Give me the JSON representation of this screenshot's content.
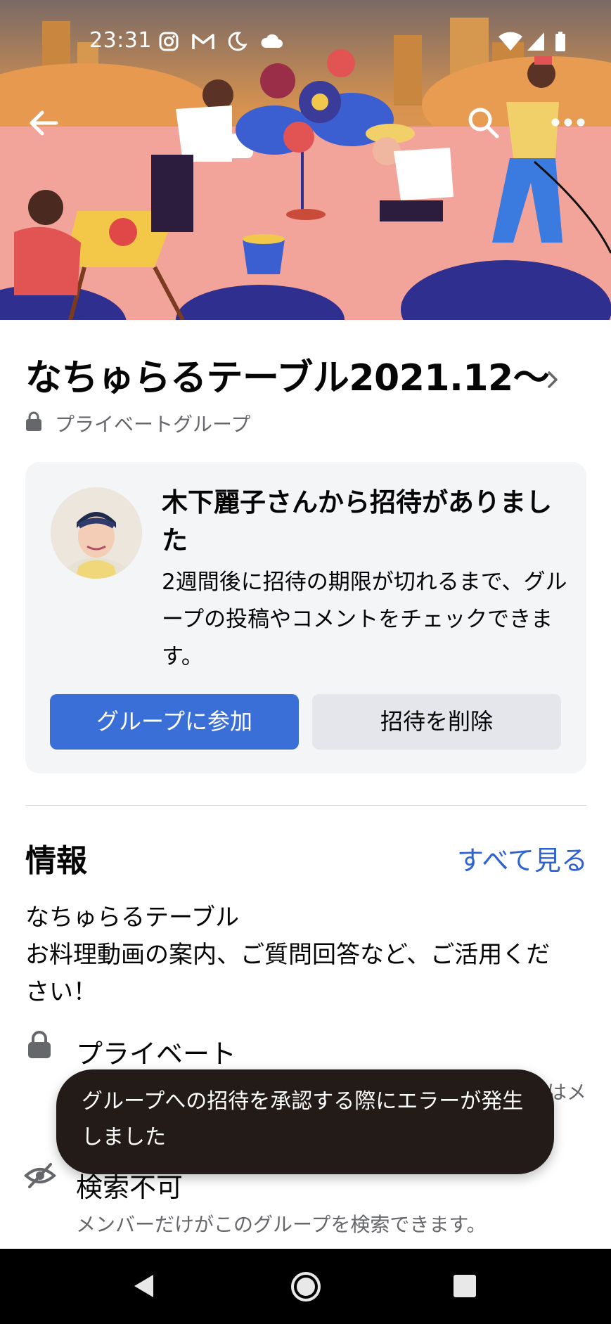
{
  "status_bar": {
    "time": "23:31",
    "icons": [
      "instagram-icon",
      "gmail-icon",
      "do-not-disturb-icon",
      "cloud-icon",
      "wifi-icon",
      "signal-icon",
      "battery-icon"
    ]
  },
  "cover_nav": {
    "back_icon": "back-arrow-icon",
    "search_icon": "search-icon",
    "more_icon": "more-icon"
  },
  "group": {
    "title": "なちゅらるテーブル2021.12〜",
    "privacy_label": "プライベートグループ"
  },
  "invite": {
    "title": "木下麗子さんから招待がありました",
    "description": "2週間後に招待の期限が切れるまで、グループの投稿やコメントをチェックできます。",
    "join_label": "グループに参加",
    "delete_label": "招待を削除"
  },
  "info": {
    "heading": "情報",
    "see_all": "すべて見る",
    "description_lines": [
      "なちゅらるテーブル",
      "お料理動画の案内、ご質問回答など、ご活用くだ",
      "さい！"
    ],
    "private_title": "プライベート",
    "private_clipped": "はメ",
    "hidden_title": "検索不可",
    "hidden_desc": "メンバーだけがこのグループを検索できます。"
  },
  "toast": {
    "message": "グループへの招待を承認する際にエラーが発生しました"
  },
  "nav_bar": {
    "back": "nav-back-icon",
    "home": "nav-home-icon",
    "recents": "nav-recents-icon"
  },
  "colors": {
    "primary_button": "#3a6fd8",
    "link": "#2f63d4",
    "card_bg": "#f4f5f7",
    "toast_bg": "#231b18"
  }
}
